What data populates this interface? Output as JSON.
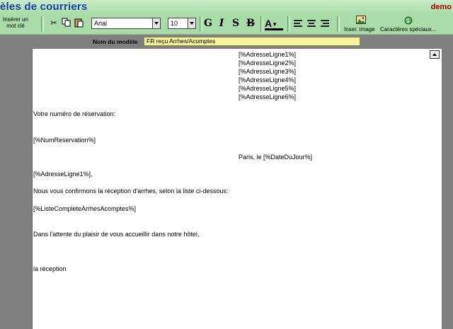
{
  "window": {
    "title": "èles de courriers",
    "demo": "demo"
  },
  "toolbar": {
    "insert_word_line1": "Insérer un",
    "insert_word_line2": "mot clé",
    "font_value": "Arial",
    "size_value": "10",
    "bold_label": "G",
    "italic_label": "I",
    "underline_label": "S",
    "strike_label": "B",
    "color_label": "A",
    "insert_image_label": "Inser. image",
    "special_chars_label": "Caractères spéciaux..."
  },
  "model": {
    "label": "Nom du modèle",
    "value": "FR reçu Arrhes/Acomptes"
  },
  "document": {
    "addr1": "[%AdresseLigne1%]",
    "addr2": "[%AdresseLigne2%]",
    "addr3": "[%AdresseLigne3%]",
    "addr4": "[%AdresseLigne4%]",
    "addr5": "[%AdresseLigne5%]",
    "addr6": "[%AdresseLigne6%]",
    "reservation_label": "Votre numéro de réservation:",
    "reservation_value": "[%NumReservation%]",
    "date_line": "Paris, le [%DateDuJour%]",
    "salutation": "[%AdresseLigne1%],",
    "confirm": "Nous vous confirmons la réception d'arrhes, selon la liste ci-dessous:",
    "list": "[%ListeCompleteArrhesAcomptes%]",
    "closing": "Dans l'attente du plaisir de vous accueillir dans notre hôtel,",
    "signature": "la réception"
  }
}
